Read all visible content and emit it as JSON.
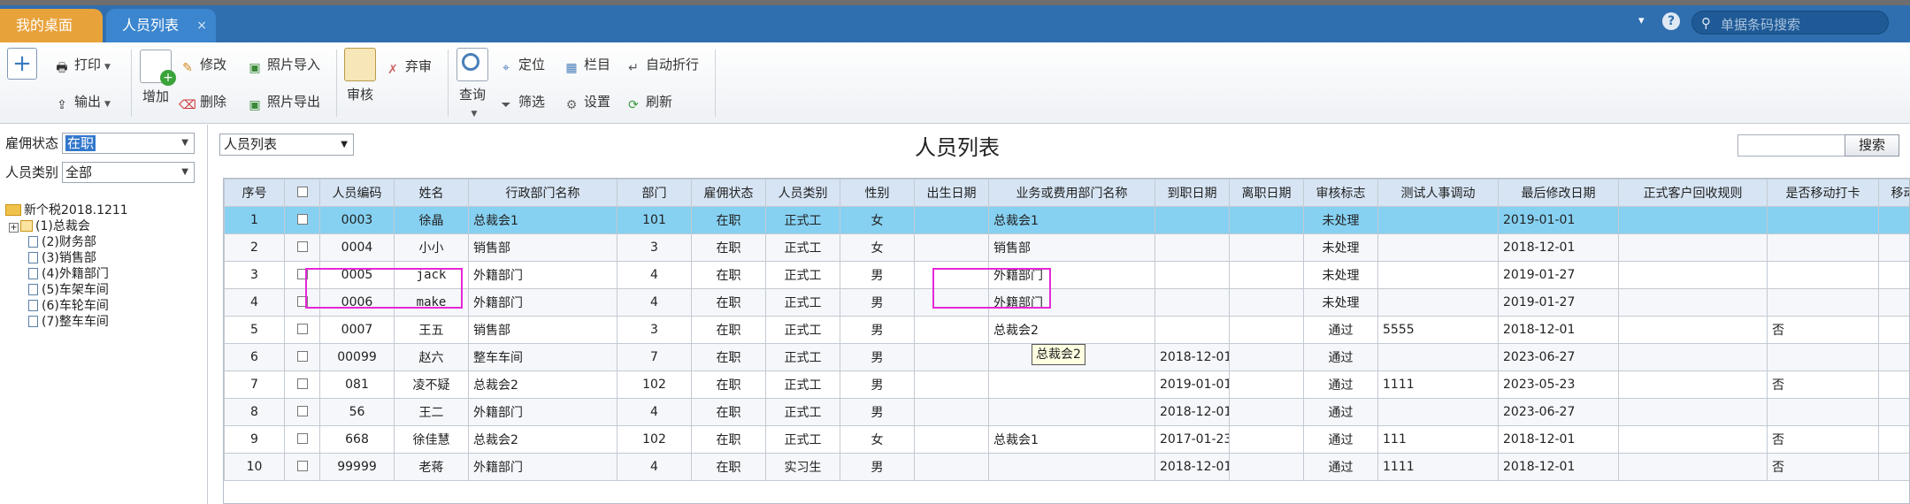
{
  "topbar": {
    "tab_desktop": "我的桌面",
    "tab_list": "人员列表",
    "tab_close": "×",
    "dropdown_icon": "▾",
    "help_icon": "?",
    "search_placeholder": "单据条码搜索"
  },
  "toolbar": {
    "print": "打印",
    "export": "输出",
    "add": "增加",
    "edit": "修改",
    "delete": "删除",
    "photo_import": "照片导入",
    "photo_export": "照片导出",
    "audit": "审核",
    "abandon": "弃审",
    "query": "查询",
    "locate": "定位",
    "filter": "筛选",
    "columns": "栏目",
    "wrap": "自动折行",
    "settings": "设置",
    "refresh": "刷新"
  },
  "left": {
    "employment_label": "雇佣状态",
    "employment_value": "在职",
    "category_label": "人员类别",
    "category_value": "全部",
    "tree": {
      "root": "新个税2018.1211",
      "level1": "(1)总裁会",
      "children": [
        "(2)财务部",
        "(3)销售部",
        "(4)外籍部门",
        "(5)车架车间",
        "(6)车轮车间",
        "(7)整车车间"
      ]
    }
  },
  "main": {
    "view_select": "人员列表",
    "title": "人员列表",
    "search_button": "搜索"
  },
  "table": {
    "columns": [
      "序号",
      "",
      "人员编码",
      "姓名",
      "行政部门名称",
      "部门",
      "雇佣状态",
      "人员类别",
      "性别",
      "出生日期",
      "业务或费用部门名称",
      "到职日期",
      "离职日期",
      "审核标志",
      "测试人事调动",
      "最后修改日期",
      "正式客户回收规则",
      "是否移动打卡",
      "移动考勤"
    ],
    "rows": [
      [
        "1",
        "",
        "0003",
        "徐晶",
        "总裁会1",
        "101",
        "在职",
        "正式工",
        "女",
        "",
        "总裁会1",
        "",
        "",
        "未处理",
        "",
        "2019-01-01",
        "",
        "",
        ""
      ],
      [
        "2",
        "",
        "0004",
        "小小",
        "销售部",
        "3",
        "在职",
        "正式工",
        "女",
        "",
        "销售部",
        "",
        "",
        "未处理",
        "",
        "2018-12-01",
        "",
        "",
        ""
      ],
      [
        "3",
        "",
        "0005",
        "jack",
        "外籍部门",
        "4",
        "在职",
        "正式工",
        "男",
        "",
        "外籍部门",
        "",
        "",
        "未处理",
        "",
        "2019-01-27",
        "",
        "",
        ""
      ],
      [
        "4",
        "",
        "0006",
        "make",
        "外籍部门",
        "4",
        "在职",
        "正式工",
        "男",
        "",
        "外籍部门",
        "",
        "",
        "未处理",
        "",
        "2019-01-27",
        "",
        "",
        ""
      ],
      [
        "5",
        "",
        "0007",
        "王五",
        "销售部",
        "3",
        "在职",
        "正式工",
        "男",
        "",
        "总裁会2",
        "",
        "",
        "通过",
        "5555",
        "2018-12-01",
        "",
        "否",
        ""
      ],
      [
        "6",
        "",
        "00099",
        "赵六",
        "整车车间",
        "7",
        "在职",
        "正式工",
        "男",
        "",
        "",
        "2018-12-01",
        "",
        "通过",
        "",
        "2023-06-27",
        "",
        "",
        ""
      ],
      [
        "7",
        "",
        "081",
        "凌不疑",
        "总裁会2",
        "102",
        "在职",
        "正式工",
        "男",
        "",
        "",
        "2019-01-01",
        "",
        "通过",
        "1111",
        "2023-05-23",
        "",
        "否",
        ""
      ],
      [
        "8",
        "",
        "56",
        "王二",
        "外籍部门",
        "4",
        "在职",
        "正式工",
        "男",
        "",
        "",
        "2018-12-01",
        "",
        "通过",
        "",
        "2023-06-27",
        "",
        "",
        ""
      ],
      [
        "9",
        "",
        "668",
        "徐佳慧",
        "总裁会2",
        "102",
        "在职",
        "正式工",
        "女",
        "",
        "总裁会1",
        "2017-01-23",
        "",
        "通过",
        "111",
        "2018-12-01",
        "",
        "否",
        ""
      ],
      [
        "10",
        "",
        "99999",
        "老蒋",
        "外籍部门",
        "4",
        "在职",
        "实习生",
        "男",
        "",
        "",
        "2018-12-01",
        "",
        "通过",
        "1111",
        "2018-12-01",
        "",
        "否",
        ""
      ]
    ]
  },
  "tooltip": "总裁会2"
}
